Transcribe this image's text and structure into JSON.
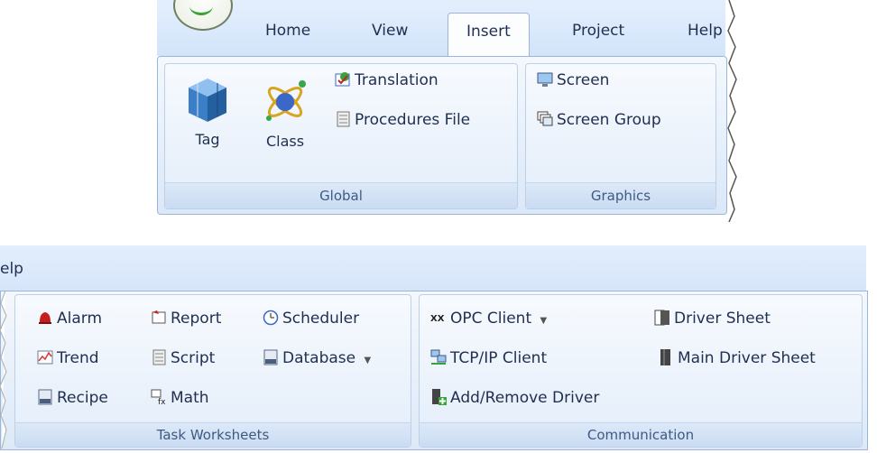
{
  "top_ribbon": {
    "tabs": [
      "Home",
      "View",
      "Insert",
      "Project",
      "Help"
    ],
    "active_tab": "Insert",
    "global_group": {
      "label": "Global",
      "tag": "Tag",
      "class": "Class",
      "translation": "Translation",
      "procedures_file": "Procedures File"
    },
    "graphics_group": {
      "label": "Graphics",
      "screen": "Screen",
      "screen_group": "Screen Group"
    }
  },
  "bottom_ribbon": {
    "help_tab": "elp",
    "task_group": {
      "label": "Task Worksheets",
      "alarm": "Alarm",
      "report": "Report",
      "scheduler": "Scheduler",
      "trend": "Trend",
      "script": "Script",
      "database": "Database",
      "recipe": "Recipe",
      "math": "Math"
    },
    "comm_group": {
      "label": "Communication",
      "opc_client": "OPC Client",
      "driver_sheet": "Driver Sheet",
      "tcpip_client": "TCP/IP Client",
      "main_driver_sheet": "Main Driver Sheet",
      "add_remove_driver": "Add/Remove Driver"
    }
  },
  "colors": {
    "accent_text": "#15428b",
    "ribbon_bg": "#dbe8f8",
    "border": "#9ab6d9"
  }
}
